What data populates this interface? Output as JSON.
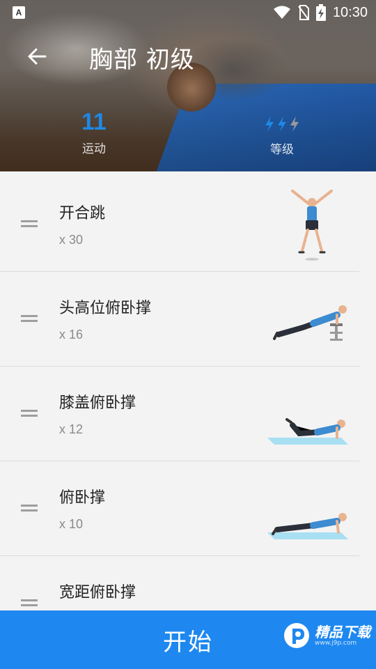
{
  "status_bar": {
    "app_badge": "A",
    "time": "10:30"
  },
  "header": {
    "title": "胸部 初级",
    "stats": {
      "exercises_value": "11",
      "exercises_label": "运动",
      "level_label": "等级",
      "level": 2,
      "level_max": 3
    }
  },
  "exercises": [
    {
      "name": "开合跳",
      "reps": "x 30",
      "illustration": "jumping-jacks"
    },
    {
      "name": "头高位俯卧撑",
      "reps": "x 16",
      "illustration": "incline-pushup"
    },
    {
      "name": "膝盖俯卧撑",
      "reps": "x 12",
      "illustration": "knee-pushup"
    },
    {
      "name": "俯卧撑",
      "reps": "x 10",
      "illustration": "pushup"
    },
    {
      "name": "宽距俯卧撑",
      "reps": "",
      "illustration": "wide-pushup"
    }
  ],
  "start_button": {
    "label": "开始"
  },
  "watermark": {
    "text": "精品下载",
    "sub": "www.j9p.com"
  },
  "colors": {
    "accent": "#1e88f0",
    "level_active": "#1e88e5",
    "level_inactive": "#9a9a9a"
  }
}
